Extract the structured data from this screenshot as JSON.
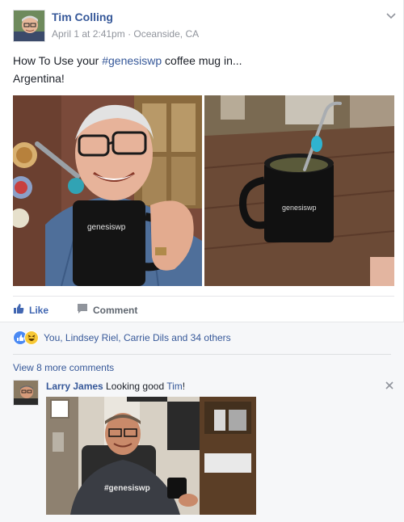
{
  "post": {
    "author": "Tim Colling",
    "date": "April 1 at 2:41pm",
    "separator": "·",
    "location": "Oceanside, CA",
    "text_before": "How To Use your ",
    "hashtag": "#genesiswp",
    "text_after": " coffee mug in...",
    "text_line2": "Argentina!",
    "mug_brand": "genesiswp",
    "chevron_icon": "chevron-down-icon"
  },
  "actions": {
    "like_label": "Like",
    "comment_label": "Comment"
  },
  "reactions": {
    "summary": "You, Lindsey Riel, Carrie Dils and 34 others",
    "icons": [
      "like-reaction-icon",
      "haha-reaction-icon"
    ]
  },
  "comments": {
    "view_more": "View 8 more comments",
    "items": [
      {
        "author": "Larry James",
        "text": " Looking good ",
        "tag": "Tim",
        "punctuation": "!",
        "shirt_text": "#genesiswp"
      }
    ]
  },
  "colors": {
    "link": "#365899",
    "like_blue": "#4267b2",
    "muted": "#90949c",
    "comment_bg": "#f6f7f9"
  }
}
